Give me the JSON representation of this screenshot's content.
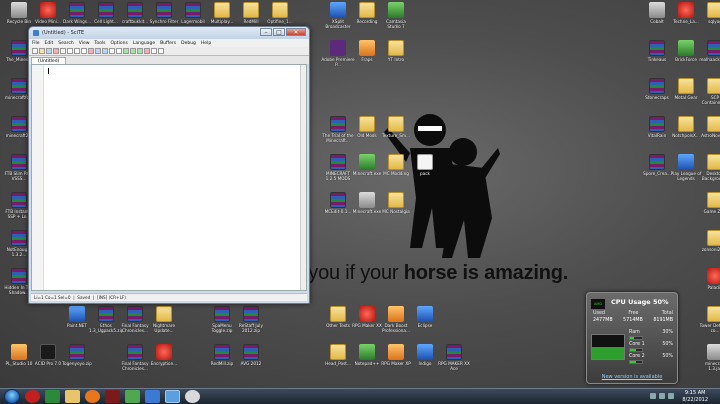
{
  "wallpaper": {
    "text_normal": "n you if your ",
    "text_bold": "horse is amazing."
  },
  "desktop_icons": [
    {
      "label": "Recycle Bin",
      "glyph": "g-gray",
      "col": 0,
      "row": 0
    },
    {
      "label": "Video Mini...",
      "glyph": "g-red",
      "col": 1,
      "row": 0
    },
    {
      "label": "Dark Wings...",
      "glyph": "g-rar",
      "col": 2,
      "row": 0
    },
    {
      "label": "Cell Light...",
      "glyph": "g-rar",
      "col": 3,
      "row": 0
    },
    {
      "label": "craftbukkit...",
      "glyph": "g-rar",
      "col": 4,
      "row": 0
    },
    {
      "label": "Synchro Filter",
      "glyph": "g-rar",
      "col": 5,
      "row": 0
    },
    {
      "label": "Lagermobil",
      "glyph": "g-rar",
      "col": 6,
      "row": 0
    },
    {
      "label": "Multiplay...",
      "glyph": "g-folder",
      "col": 7,
      "row": 0
    },
    {
      "label": "RedMill",
      "glyph": "g-folder",
      "col": 8,
      "row": 0
    },
    {
      "label": "Optifine_1...",
      "glyph": "g-folder",
      "col": 9,
      "row": 0
    },
    {
      "label": "XSplit Broadcaster",
      "glyph": "g-blue",
      "col": 11,
      "row": 0
    },
    {
      "label": "Recording",
      "glyph": "g-folder",
      "col": 12,
      "row": 0
    },
    {
      "label": "Camtasia Studio 7",
      "glyph": "g-green",
      "col": 13,
      "row": 0
    },
    {
      "label": "Adobe Premiere P...",
      "glyph": "g-purple",
      "col": 11,
      "row": 1
    },
    {
      "label": "Fraps",
      "glyph": "g-orange",
      "col": 12,
      "row": 1
    },
    {
      "label": "YT Intro",
      "glyph": "g-folder",
      "col": 13,
      "row": 1
    },
    {
      "label": "The_Mines...",
      "glyph": "g-rar",
      "col": 0,
      "row": 1
    },
    {
      "label": "minecraftfo...",
      "glyph": "g-rar",
      "col": 0,
      "row": 2
    },
    {
      "label": "minecraft2...",
      "glyph": "g-rar",
      "col": 0,
      "row": 3
    },
    {
      "label": "FTB Slim Pack VSSS...",
      "glyph": "g-rar",
      "col": 0,
      "row": 4
    },
    {
      "label": "FTB Instantly SSP + Lo...",
      "glyph": "g-rar",
      "col": 0,
      "row": 5
    },
    {
      "label": "NotEnoug... 1.3.2...",
      "glyph": "g-rar",
      "col": 0,
      "row": 6
    },
    {
      "label": "Hidden In The Shadow...",
      "glyph": "g-rar",
      "col": 0,
      "row": 7
    },
    {
      "label": "The Trial of the Minecraft...",
      "glyph": "g-rar",
      "col": 11,
      "row": 3
    },
    {
      "label": "Old Mods",
      "glyph": "g-folder",
      "col": 12,
      "row": 3
    },
    {
      "label": "Texture_Sm...",
      "glyph": "g-folder",
      "col": 13,
      "row": 3
    },
    {
      "label": "MINECRAFT 1.2.5 MODS",
      "glyph": "g-rar",
      "col": 11,
      "row": 4
    },
    {
      "label": "Minecraft.exe",
      "glyph": "g-green",
      "col": 12,
      "row": 4
    },
    {
      "label": "MC Modding",
      "glyph": "g-folder",
      "col": 13,
      "row": 4
    },
    {
      "label": "MCEdit-0.1...",
      "glyph": "g-rar",
      "col": 11,
      "row": 5
    },
    {
      "label": "Minecraft.exe",
      "glyph": "g-gray",
      "col": 12,
      "row": 5
    },
    {
      "label": "MC Nostalgia",
      "glyph": "g-folder",
      "col": 13,
      "row": 5
    },
    {
      "label": "pack",
      "glyph": "g-doc",
      "col": 14,
      "row": 4
    },
    {
      "label": "Cobalt",
      "glyph": "g-gray",
      "col": 22,
      "row": 0
    },
    {
      "label": "Techne_La...",
      "glyph": "g-red",
      "col": 23,
      "row": 0
    },
    {
      "label": "sqlyog",
      "glyph": "g-folder",
      "col": 24,
      "row": 0
    },
    {
      "label": "Tinkeaus",
      "glyph": "g-rar",
      "col": 22,
      "row": 1
    },
    {
      "label": "BrickForce",
      "glyph": "g-green",
      "col": 23,
      "row": 1
    },
    {
      "label": "realhaack-85...",
      "glyph": "g-rar",
      "col": 24,
      "row": 1
    },
    {
      "label": "Stonecraps",
      "glyph": "g-rar",
      "col": 22,
      "row": 2
    },
    {
      "label": "Metal Gear",
      "glyph": "g-folder",
      "col": 23,
      "row": 2
    },
    {
      "label": "SCP Containme...",
      "glyph": "g-folder",
      "col": 24,
      "row": 2
    },
    {
      "label": "VitalRain",
      "glyph": "g-rar",
      "col": 22,
      "row": 3
    },
    {
      "label": "NotchpolsX...",
      "glyph": "g-folder",
      "col": 23,
      "row": 3
    },
    {
      "label": "AstroNovas...",
      "glyph": "g-folder",
      "col": 24,
      "row": 3
    },
    {
      "label": "Spore_Crea...",
      "glyph": "g-rar",
      "col": 22,
      "row": 4
    },
    {
      "label": "Play League of Legends",
      "glyph": "g-blue",
      "col": 23,
      "row": 4
    },
    {
      "label": "Desktop Backgroun...",
      "glyph": "g-folder",
      "col": 24,
      "row": 4
    },
    {
      "label": "Game Zips",
      "glyph": "g-folder",
      "col": 24,
      "row": 5
    },
    {
      "label": "zonsoni2.E...",
      "glyph": "g-folder",
      "col": 24,
      "row": 6
    },
    {
      "label": "Paladin",
      "glyph": "g-red",
      "col": 24,
      "row": 7
    },
    {
      "label": "Tower Defense co...",
      "glyph": "g-folder",
      "col": 24,
      "row": 8
    },
    {
      "label": "minecraft 1.3.jar",
      "glyph": "g-gray",
      "col": 24,
      "row": 9
    },
    {
      "label": "Paint.NET",
      "glyph": "g-blue",
      "col": 2,
      "row": 8
    },
    {
      "label": "Ethos 1.3_Ugpack5.zip",
      "glyph": "g-rar",
      "col": 3,
      "row": 8
    },
    {
      "label": "Final Fantasy Chronicles...",
      "glyph": "g-rar",
      "col": 4,
      "row": 8
    },
    {
      "label": "Nightmare Update...",
      "glyph": "g-folder",
      "col": 5,
      "row": 8
    },
    {
      "label": "SpaMenu Toggle.zip",
      "glyph": "g-rar",
      "col": 7,
      "row": 8
    },
    {
      "label": "ReStaff July 2012.zip",
      "glyph": "g-rar",
      "col": 8,
      "row": 8
    },
    {
      "label": "Other Texts",
      "glyph": "g-folder",
      "col": 11,
      "row": 8
    },
    {
      "label": "RPG Maker XX",
      "glyph": "g-red",
      "col": 12,
      "row": 8
    },
    {
      "label": "Dark Boost Professiona...",
      "glyph": "g-orange",
      "col": 13,
      "row": 8
    },
    {
      "label": "Eclipse",
      "glyph": "g-blue",
      "col": 14,
      "row": 8
    },
    {
      "label": "PL_Studio 10",
      "glyph": "g-orange",
      "col": 0,
      "row": 9
    },
    {
      "label": "ACID Pro 7.0",
      "glyph": "g-black",
      "col": 1,
      "row": 9
    },
    {
      "label": "Togenyoyo.zip",
      "glyph": "g-rar",
      "col": 2,
      "row": 9
    },
    {
      "label": "Final Fantasy Chronicles...",
      "glyph": "g-rar",
      "col": 4,
      "row": 9
    },
    {
      "label": "Encryption...",
      "glyph": "g-red",
      "col": 5,
      "row": 9
    },
    {
      "label": "RedMill.zip",
      "glyph": "g-rar",
      "col": 7,
      "row": 9
    },
    {
      "label": "AVG 2012",
      "glyph": "g-rar",
      "col": 8,
      "row": 9
    },
    {
      "label": "Head_Post...",
      "glyph": "g-folder",
      "col": 11,
      "row": 9
    },
    {
      "label": "Notepad++",
      "glyph": "g-green",
      "col": 12,
      "row": 9
    },
    {
      "label": "RPG Maker XP",
      "glyph": "g-orange",
      "col": 13,
      "row": 9
    },
    {
      "label": "Indigo",
      "glyph": "g-blue",
      "col": 14,
      "row": 9
    },
    {
      "label": "RPG MAKER XX Ace",
      "glyph": "g-rar",
      "col": 15,
      "row": 9
    }
  ],
  "scite": {
    "title": "(Untitled) - SciTE",
    "menu": [
      "File",
      "Edit",
      "Search",
      "View",
      "Tools",
      "Options",
      "Language",
      "Buffers",
      "Debug",
      "Help"
    ],
    "tab": "(Untitled)",
    "status": "Li=1 Co=1 Sel=0  |  Saved  |  [INS] (CR+LF)"
  },
  "cpu_gadget": {
    "title": "CPU Usage",
    "usage": "50%",
    "headers": [
      "Used",
      "Free",
      "Total"
    ],
    "values": [
      "2477MB",
      "5714MB",
      "8191MB"
    ],
    "ram_label": "Ram",
    "ram_pct": "30%",
    "ram_fraction": 0.3,
    "core1_label": "Core 1",
    "core1_pct": "50%",
    "core1_fraction": 0.5,
    "core2_label": "Core 2",
    "core2_pct": "50%",
    "core2_fraction": 0.5,
    "link": "New version is available"
  },
  "taskbar": {
    "time": "9:15 AM",
    "date": "8/22/2012"
  },
  "colors": {
    "desktop_bg": "#4e4e4e",
    "taskbar": "#1c2530",
    "accent_green": "#2e9e2e"
  }
}
